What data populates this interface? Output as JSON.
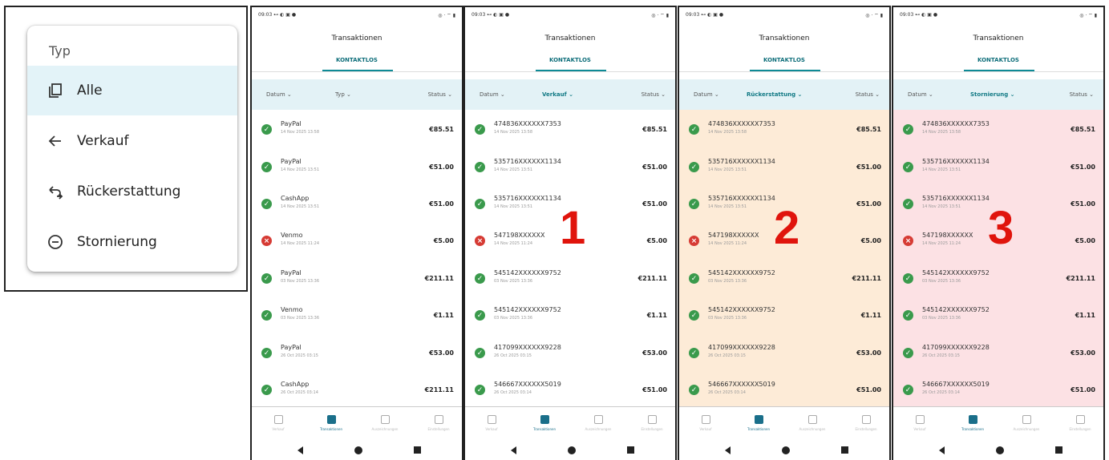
{
  "menu": {
    "title": "Typ",
    "items": [
      {
        "label": "Alle",
        "icon": "copy-icon",
        "selected": true
      },
      {
        "label": "Verkauf",
        "icon": "arrow-left-icon",
        "selected": false
      },
      {
        "label": "Rückerstattung",
        "icon": "return-arrow-icon",
        "selected": false
      },
      {
        "label": "Stornierung",
        "icon": "minus-circle-icon",
        "selected": false
      }
    ]
  },
  "status_bar": {
    "left": "09:03 ⊷ ◐ ▣ ●",
    "right": "◎ · ⌔ ▮"
  },
  "header": {
    "title": "Transaktionen",
    "tab": "KONTAKTLOS"
  },
  "nav": {
    "items": [
      "Verkauf",
      "Transaktionen",
      "Auszeichnungen",
      "Einstellungen"
    ]
  },
  "colors": {
    "accent": "#0e8a96",
    "filter_bg": "#e3f2f6",
    "success": "#3a9a4c",
    "error": "#d63b34",
    "overlay_text": "#e0140c"
  },
  "phones": [
    {
      "filters": {
        "date": "Datum ⌄",
        "type": "Typ ⌄",
        "status": "Status ⌄"
      },
      "type_active": false,
      "list_bg": "#ffffff",
      "overlay": "",
      "rows": [
        {
          "name": "PayPal",
          "date": "14 Nov 2025 13:58",
          "amount": "€85.51",
          "status": "ok"
        },
        {
          "name": "PayPal",
          "date": "14 Nov 2025 13:51",
          "amount": "€51.00",
          "status": "ok"
        },
        {
          "name": "CashApp",
          "date": "14 Nov 2025 13:51",
          "amount": "€51.00",
          "status": "ok"
        },
        {
          "name": "Venmo",
          "date": "14 Nov 2025 11:24",
          "amount": "€5.00",
          "status": "err"
        },
        {
          "name": "PayPal",
          "date": "03 Nov 2025 13:36",
          "amount": "€211.11",
          "status": "ok"
        },
        {
          "name": "Venmo",
          "date": "03 Nov 2025 13:36",
          "amount": "€1.11",
          "status": "ok"
        },
        {
          "name": "PayPal",
          "date": "26 Oct 2025 03:15",
          "amount": "€53.00",
          "status": "ok"
        },
        {
          "name": "CashApp",
          "date": "26 Oct 2025 03:14",
          "amount": "€211.11",
          "status": "ok"
        }
      ]
    },
    {
      "filters": {
        "date": "Datum ⌄",
        "type": "Verkauf ⌄",
        "status": "Status ⌄"
      },
      "type_active": true,
      "list_bg": "#ffffff",
      "overlay": "1",
      "rows": [
        {
          "name": "474836XXXXXX7353",
          "date": "14 Nov 2025 13:58",
          "amount": "€85.51",
          "status": "ok"
        },
        {
          "name": "535716XXXXXX1134",
          "date": "14 Nov 2025 13:51",
          "amount": "€51.00",
          "status": "ok"
        },
        {
          "name": "535716XXXXXX1134",
          "date": "14 Nov 2025 13:51",
          "amount": "€51.00",
          "status": "ok"
        },
        {
          "name": "547198XXXXXX",
          "date": "14 Nov 2025 11:24",
          "amount": "€5.00",
          "status": "err"
        },
        {
          "name": "545142XXXXXX9752",
          "date": "03 Nov 2025 13:36",
          "amount": "€211.11",
          "status": "ok"
        },
        {
          "name": "545142XXXXXX9752",
          "date": "03 Nov 2025 13:36",
          "amount": "€1.11",
          "status": "ok"
        },
        {
          "name": "417099XXXXXX9228",
          "date": "26 Oct 2025 03:15",
          "amount": "€53.00",
          "status": "ok"
        },
        {
          "name": "546667XXXXXX5019",
          "date": "26 Oct 2025 03:14",
          "amount": "€51.00",
          "status": "ok"
        }
      ]
    },
    {
      "filters": {
        "date": "Datum ⌄",
        "type": "Rückerstattung ⌄",
        "status": "Status ⌄"
      },
      "type_active": true,
      "list_bg": "#fdebd7",
      "overlay": "2",
      "rows": [
        {
          "name": "474836XXXXXX7353",
          "date": "14 Nov 2025 13:58",
          "amount": "€85.51",
          "status": "ok"
        },
        {
          "name": "535716XXXXXX1134",
          "date": "14 Nov 2025 13:51",
          "amount": "€51.00",
          "status": "ok"
        },
        {
          "name": "535716XXXXXX1134",
          "date": "14 Nov 2025 13:51",
          "amount": "€51.00",
          "status": "ok"
        },
        {
          "name": "547198XXXXXX",
          "date": "14 Nov 2025 11:24",
          "amount": "€5.00",
          "status": "err"
        },
        {
          "name": "545142XXXXXX9752",
          "date": "03 Nov 2025 13:36",
          "amount": "€211.11",
          "status": "ok"
        },
        {
          "name": "545142XXXXXX9752",
          "date": "03 Nov 2025 13:36",
          "amount": "€1.11",
          "status": "ok"
        },
        {
          "name": "417099XXXXXX9228",
          "date": "26 Oct 2025 03:15",
          "amount": "€53.00",
          "status": "ok"
        },
        {
          "name": "546667XXXXXX5019",
          "date": "26 Oct 2025 03:14",
          "amount": "€51.00",
          "status": "ok"
        }
      ]
    },
    {
      "filters": {
        "date": "Datum ⌄",
        "type": "Stornierung ⌄",
        "status": "Status ⌄"
      },
      "type_active": true,
      "list_bg": "#fce1e4",
      "overlay": "3",
      "rows": [
        {
          "name": "474836XXXXXX7353",
          "date": "14 Nov 2025 13:58",
          "amount": "€85.51",
          "status": "ok"
        },
        {
          "name": "535716XXXXXX1134",
          "date": "14 Nov 2025 13:51",
          "amount": "€51.00",
          "status": "ok"
        },
        {
          "name": "535716XXXXXX1134",
          "date": "14 Nov 2025 13:51",
          "amount": "€51.00",
          "status": "ok"
        },
        {
          "name": "547198XXXXXX",
          "date": "14 Nov 2025 11:24",
          "amount": "€5.00",
          "status": "err"
        },
        {
          "name": "545142XXXXXX9752",
          "date": "03 Nov 2025 13:36",
          "amount": "€211.11",
          "status": "ok"
        },
        {
          "name": "545142XXXXXX9752",
          "date": "03 Nov 2025 13:36",
          "amount": "€1.11",
          "status": "ok"
        },
        {
          "name": "417099XXXXXX9228",
          "date": "26 Oct 2025 03:15",
          "amount": "€53.00",
          "status": "ok"
        },
        {
          "name": "546667XXXXXX5019",
          "date": "26 Oct 2025 03:14",
          "amount": "€51.00",
          "status": "ok"
        }
      ]
    }
  ]
}
